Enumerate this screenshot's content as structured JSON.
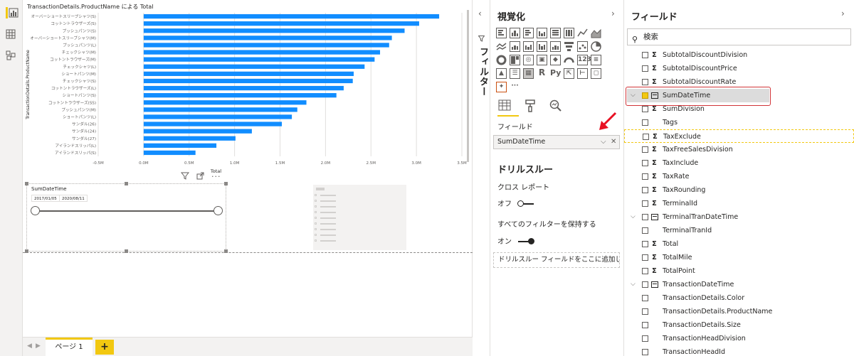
{
  "chart_data": {
    "type": "bar",
    "orientation": "horizontal",
    "title": "TransactionDetails.ProductName による Total",
    "xlabel": "Total",
    "ylabel": "TransactionDetails.ProductName",
    "xlim": [
      -500000,
      3500000
    ],
    "x_ticks": [
      "-0.5M",
      "0.0M",
      "0.5M",
      "1.0M",
      "1.5M",
      "2.0M",
      "2.5M",
      "3.0M",
      "3.5M"
    ],
    "x_tick_values": [
      -500000,
      0,
      500000,
      1000000,
      1500000,
      2000000,
      2500000,
      3000000,
      3500000
    ],
    "categories": [
      "オーバーショートスリーブシャツ(S)",
      "コットントラウザーズ(S)",
      "プッシュパンツ(S)",
      "オーバーショートスリーブシャツ(M)",
      "プッシュパンツ(L)",
      "チェックシャツ(M)",
      "コットントラウザーズ(M)",
      "チェックシャツ(L)",
      "ショートパンツ(M)",
      "チェックシャツ(S)",
      "コットントラウザーズ(L)",
      "ショートパンツ(S)",
      "コットントラウザーズ(SS)",
      "プッシュパンツ(M)",
      "ショートパンツ(L)",
      "サンダル(26)",
      "サンダル(24)",
      "サンダル(27)",
      "アイランドスリッパ(L)",
      "アイランドスリッパ(S)"
    ],
    "values": [
      3250000,
      3030000,
      2870000,
      2730000,
      2700000,
      2600000,
      2540000,
      2430000,
      2310000,
      2300000,
      2200000,
      2120000,
      1790000,
      1690000,
      1630000,
      1520000,
      1190000,
      1010000,
      800000,
      570000
    ],
    "color": "#118DFF",
    "grid": true
  },
  "canvas": {
    "visual_tools": {
      "filter_icon": "filter-icon",
      "focus_icon": "focus-mode-icon",
      "more_icon": "more-options-icon"
    },
    "slicer": {
      "title": "SumDateTime",
      "start_date": "2017/01/05",
      "end_date": "2020/08/11"
    }
  },
  "page_tabs": {
    "tabs": [
      {
        "label": "ページ 1"
      }
    ],
    "add_label": "+"
  },
  "filters": {
    "label": "フィルター"
  },
  "visualizations": {
    "title": "視覚化",
    "fields_label": "フィールド",
    "field_well_value": "SumDateTime",
    "drillthrough_title": "ドリルスルー",
    "cross_report_label": "クロス レポート",
    "cross_report_state": "オフ",
    "keep_filters_label": "すべてのフィルターを保持する",
    "keep_filters_state": "オン",
    "drill_drop_placeholder": "ドリルスルー フィールドをここに追加します",
    "r_label": "R",
    "py_label": "Py",
    "accent": "#F2C811"
  },
  "fields": {
    "title": "フィールド",
    "search_placeholder": "検索",
    "items": [
      {
        "name": "SubtotalDiscountDivision",
        "type": "sigma",
        "checked": false
      },
      {
        "name": "SubtotalDiscountPrice",
        "type": "sigma",
        "checked": false
      },
      {
        "name": "SubtotalDiscountRate",
        "type": "sigma",
        "checked": false
      },
      {
        "name": "SumDateTime",
        "type": "date",
        "checked": true,
        "expandable": true,
        "selected": true
      },
      {
        "name": "SumDivision",
        "type": "sigma",
        "checked": false
      },
      {
        "name": "Tags",
        "type": "text",
        "checked": false
      },
      {
        "name": "TaxExclude",
        "type": "sigma",
        "checked": false,
        "hover": true
      },
      {
        "name": "TaxFreeSalesDivision",
        "type": "sigma",
        "checked": false
      },
      {
        "name": "TaxInclude",
        "type": "sigma",
        "checked": false
      },
      {
        "name": "TaxRate",
        "type": "sigma",
        "checked": false
      },
      {
        "name": "TaxRounding",
        "type": "sigma",
        "checked": false
      },
      {
        "name": "TerminalId",
        "type": "sigma",
        "checked": false
      },
      {
        "name": "TerminalTranDateTime",
        "type": "date",
        "checked": false,
        "expandable": true
      },
      {
        "name": "TerminalTranId",
        "type": "text",
        "checked": false
      },
      {
        "name": "Total",
        "type": "sigma",
        "checked": false
      },
      {
        "name": "TotalMile",
        "type": "sigma",
        "checked": false
      },
      {
        "name": "TotalPoint",
        "type": "sigma",
        "checked": false
      },
      {
        "name": "TransactionDateTime",
        "type": "date",
        "checked": false,
        "expandable": true
      },
      {
        "name": "TransactionDetails.Color",
        "type": "text",
        "checked": false
      },
      {
        "name": "TransactionDetails.ProductName",
        "type": "text",
        "checked": false
      },
      {
        "name": "TransactionDetails.Size",
        "type": "text",
        "checked": false
      },
      {
        "name": "TransactionHeadDivision",
        "type": "text",
        "checked": false
      },
      {
        "name": "TransactionHeadId",
        "type": "text",
        "checked": false
      }
    ]
  }
}
